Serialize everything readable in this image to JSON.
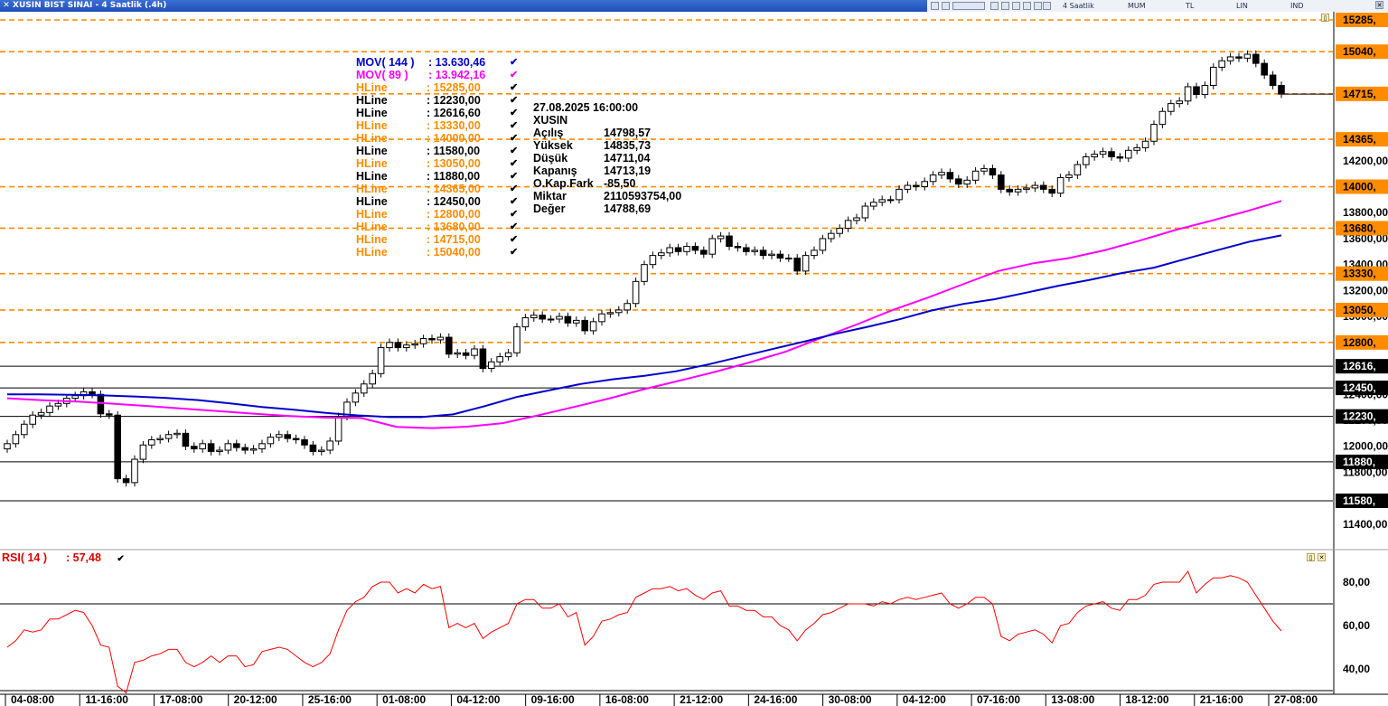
{
  "window": {
    "title": "XUSIN BIST SINAI - 4 Saatlik (.4h)"
  },
  "toolbar": {
    "period_label": "4 Saatlik",
    "chart_type_label": "MUM",
    "currency_label": "TL",
    "scale_label": "LIN",
    "indicator_label": "IND"
  },
  "legend": {
    "mov144": {
      "name": "MOV( 144 )",
      "value": ": 13.630,46",
      "color": "#0000cc"
    },
    "mov89": {
      "name": "MOV( 89 )",
      "value": ": 13.942,16",
      "color": "#ff00ff"
    },
    "hlines": [
      {
        "name": "HLine",
        "value": ": 15285,00",
        "color": "#ff8c00"
      },
      {
        "name": "HLine",
        "value": ": 12230,00",
        "color": "#000000"
      },
      {
        "name": "HLine",
        "value": ": 12616,60",
        "color": "#000000"
      },
      {
        "name": "HLine",
        "value": ": 13330,00",
        "color": "#ff8c00"
      },
      {
        "name": "HLine",
        "value": ": 14000,00",
        "color": "#ff8c00"
      },
      {
        "name": "HLine",
        "value": ": 11580,00",
        "color": "#000000"
      },
      {
        "name": "HLine",
        "value": ": 13050,00",
        "color": "#ff8c00"
      },
      {
        "name": "HLine",
        "value": ": 11880,00",
        "color": "#000000"
      },
      {
        "name": "HLine",
        "value": ": 14365,00",
        "color": "#ff8c00"
      },
      {
        "name": "HLine",
        "value": ": 12450,00",
        "color": "#000000"
      },
      {
        "name": "HLine",
        "value": ": 12800,00",
        "color": "#ff8c00"
      },
      {
        "name": "HLine",
        "value": ": 13680,00",
        "color": "#ff8c00"
      },
      {
        "name": "HLine",
        "value": ": 14715,00",
        "color": "#ff8c00"
      },
      {
        "name": "HLine",
        "value": ": 15040,00",
        "color": "#ff8c00"
      }
    ]
  },
  "info": {
    "datetime": "27.08.2025  16:00:00",
    "symbol": "XUSIN",
    "rows": [
      {
        "k": "Açılış",
        "v": "14798,57"
      },
      {
        "k": "Yüksek",
        "v": "14835,73"
      },
      {
        "k": "Düşük",
        "v": "14711,04"
      },
      {
        "k": "Kapanış",
        "v": "14713,19"
      },
      {
        "k": "O.Kap.Fark",
        "v": "-85,50"
      },
      {
        "k": "Miktar",
        "v": "2110593754,00"
      },
      {
        "k": "Değer",
        "v": "14788,69"
      }
    ]
  },
  "rsi": {
    "label": "RSI( 14 )",
    "value": ": 57,48",
    "color": "#e00000"
  },
  "colors": {
    "dashed_hline": "#ff8c00",
    "solid_hline": "#000000",
    "mov144": "#0000cc",
    "mov89": "#ff00ff",
    "rsi": "#ff0000"
  },
  "chart_data": [
    {
      "type": "candlestick",
      "title": "XUSIN BIST SINAI - 4 Saatlik (.4h)",
      "x_ticks": [
        "04-08:00",
        "11-16:00",
        "17-08:00",
        "20-12:00",
        "25-16:00",
        "01-08:00",
        "04-12:00",
        "09-16:00",
        "16-08:00",
        "21-12:00",
        "24-16:00",
        "30-08:00",
        "04-12:00",
        "07-16:00",
        "13-08:00",
        "18-12:00",
        "21-16:00",
        "27-08:00"
      ],
      "y_ticks": [
        "11400,00",
        "11600,00",
        "11800,00",
        "12000,00",
        "12200,00",
        "12400,00",
        "13000,00",
        "13200,00",
        "13400,00",
        "13600,00",
        "13800,00",
        "14200,00"
      ],
      "ylim": [
        11330,
        15400
      ],
      "hlines_dashed": [
        15285,
        15040,
        14715,
        14365,
        14000,
        13680,
        13330,
        13050,
        12800
      ],
      "hlines_solid": [
        12616.6,
        12450,
        12230,
        11880,
        11580
      ],
      "hline_labels": [
        {
          "value": 15285,
          "label": "15285,"
        },
        {
          "value": 15040,
          "label": "15040,"
        },
        {
          "value": 14715,
          "label": "14715,"
        },
        {
          "value": 14365,
          "label": "14365,"
        },
        {
          "value": 14000,
          "label": "14000,"
        },
        {
          "value": 13680,
          "label": "13680,"
        },
        {
          "value": 13330,
          "label": "13330,"
        },
        {
          "value": 13050,
          "label": "13050,"
        },
        {
          "value": 12800,
          "label": "12800,"
        },
        {
          "value": 12616.6,
          "label": "12616,"
        },
        {
          "value": 12450,
          "label": "12450,"
        },
        {
          "value": 12230,
          "label": "12230,"
        },
        {
          "value": 11880,
          "label": "11880,"
        },
        {
          "value": 11580,
          "label": "11580,"
        }
      ],
      "close": [
        12020,
        12090,
        12170,
        12240,
        12260,
        12310,
        12330,
        12370,
        12390,
        12420,
        12400,
        12250,
        12240,
        11750,
        11720,
        11900,
        12010,
        12050,
        12060,
        12090,
        12100,
        12000,
        11980,
        12020,
        11960,
        11970,
        12020,
        11990,
        11970,
        11980,
        12020,
        12070,
        12090,
        12060,
        12050,
        12010,
        11960,
        11970,
        12040,
        12230,
        12340,
        12410,
        12480,
        12560,
        12760,
        12800,
        12760,
        12780,
        12790,
        12830,
        12820,
        12840,
        12710,
        12720,
        12700,
        12750,
        12600,
        12650,
        12690,
        12720,
        12920,
        12990,
        13010,
        12980,
        12980,
        13000,
        12950,
        12970,
        12890,
        12960,
        13020,
        13030,
        13050,
        13100,
        13270,
        13400,
        13470,
        13490,
        13530,
        13500,
        13540,
        13510,
        13480,
        13600,
        13620,
        13540,
        13530,
        13500,
        13510,
        13470,
        13480,
        13450,
        13450,
        13350,
        13470,
        13510,
        13600,
        13640,
        13680,
        13740,
        13760,
        13850,
        13880,
        13900,
        13900,
        13980,
        14010,
        14000,
        14040,
        14090,
        14110,
        14060,
        14020,
        14050,
        14120,
        14140,
        14090,
        13980,
        13960,
        13980,
        13990,
        14010,
        13980,
        13950,
        14070,
        14090,
        14170,
        14230,
        14250,
        14270,
        14230,
        14220,
        14280,
        14300,
        14350,
        14480,
        14580,
        14640,
        14660,
        14770,
        14710,
        14780,
        14920,
        14970,
        15000,
        14990,
        15020,
        14950,
        14860,
        14780,
        14713.19
      ],
      "mov144": [
        12400,
        12400,
        12396,
        12392,
        12384,
        12372,
        12356,
        12330,
        12303,
        12281,
        12257,
        12238,
        12225,
        12225,
        12246,
        12310,
        12380,
        12430,
        12480,
        12516,
        12543,
        12578,
        12630,
        12689,
        12748,
        12806,
        12866,
        12920,
        12978,
        13045,
        13096,
        13133,
        13184,
        13237,
        13283,
        13335,
        13376,
        13444,
        13511,
        13577,
        13625
      ],
      "mov89": [
        12370,
        12355,
        12344,
        12328,
        12310,
        12290,
        12270,
        12251,
        12233,
        12221,
        12218,
        12150,
        12140,
        12151,
        12178,
        12238,
        12302,
        12368,
        12440,
        12506,
        12573,
        12648,
        12730,
        12835,
        12938,
        13048,
        13144,
        13248,
        13350,
        13410,
        13450,
        13510,
        13584,
        13666,
        13736,
        13809,
        13890
      ],
      "value_label": "14715,"
    },
    {
      "type": "line",
      "title": "RSI( 14 )",
      "y_ticks": [
        "40,00",
        "60,00",
        "80,00"
      ],
      "ylim": [
        25,
        90
      ],
      "ref_lines": [
        70,
        30
      ],
      "series": [
        {
          "name": "RSI( 14 )",
          "values": [
            50,
            53,
            58,
            57,
            58,
            63,
            63,
            65,
            67,
            66,
            60,
            51,
            50,
            32,
            29,
            43,
            44,
            46,
            47,
            49,
            49,
            43,
            41,
            43,
            46,
            43,
            46,
            46,
            41,
            42,
            48,
            49,
            50,
            49,
            46,
            43,
            41,
            43,
            47,
            58,
            67,
            71,
            73,
            78,
            80,
            80,
            75,
            77,
            75,
            79,
            77,
            78,
            59,
            61,
            59,
            61,
            54,
            57,
            59,
            61,
            70,
            72,
            72,
            68,
            68,
            70,
            64,
            66,
            51,
            55,
            62,
            63,
            65,
            66,
            73,
            75,
            77,
            77,
            78,
            76,
            77,
            74,
            72,
            75,
            76,
            69,
            69,
            67,
            67,
            64,
            64,
            60,
            58,
            53,
            58,
            61,
            65,
            66,
            68,
            70,
            70,
            70,
            69,
            71,
            70,
            72,
            73,
            72,
            73,
            74,
            75,
            70,
            68,
            70,
            73,
            73,
            70,
            55,
            53,
            56,
            57,
            58,
            56,
            52,
            60,
            61,
            66,
            69,
            70,
            71,
            68,
            67,
            72,
            72,
            74,
            79,
            80,
            80,
            80,
            85,
            75,
            79,
            82,
            82,
            83,
            82,
            80,
            74,
            68,
            62,
            57.48
          ]
        }
      ]
    }
  ]
}
